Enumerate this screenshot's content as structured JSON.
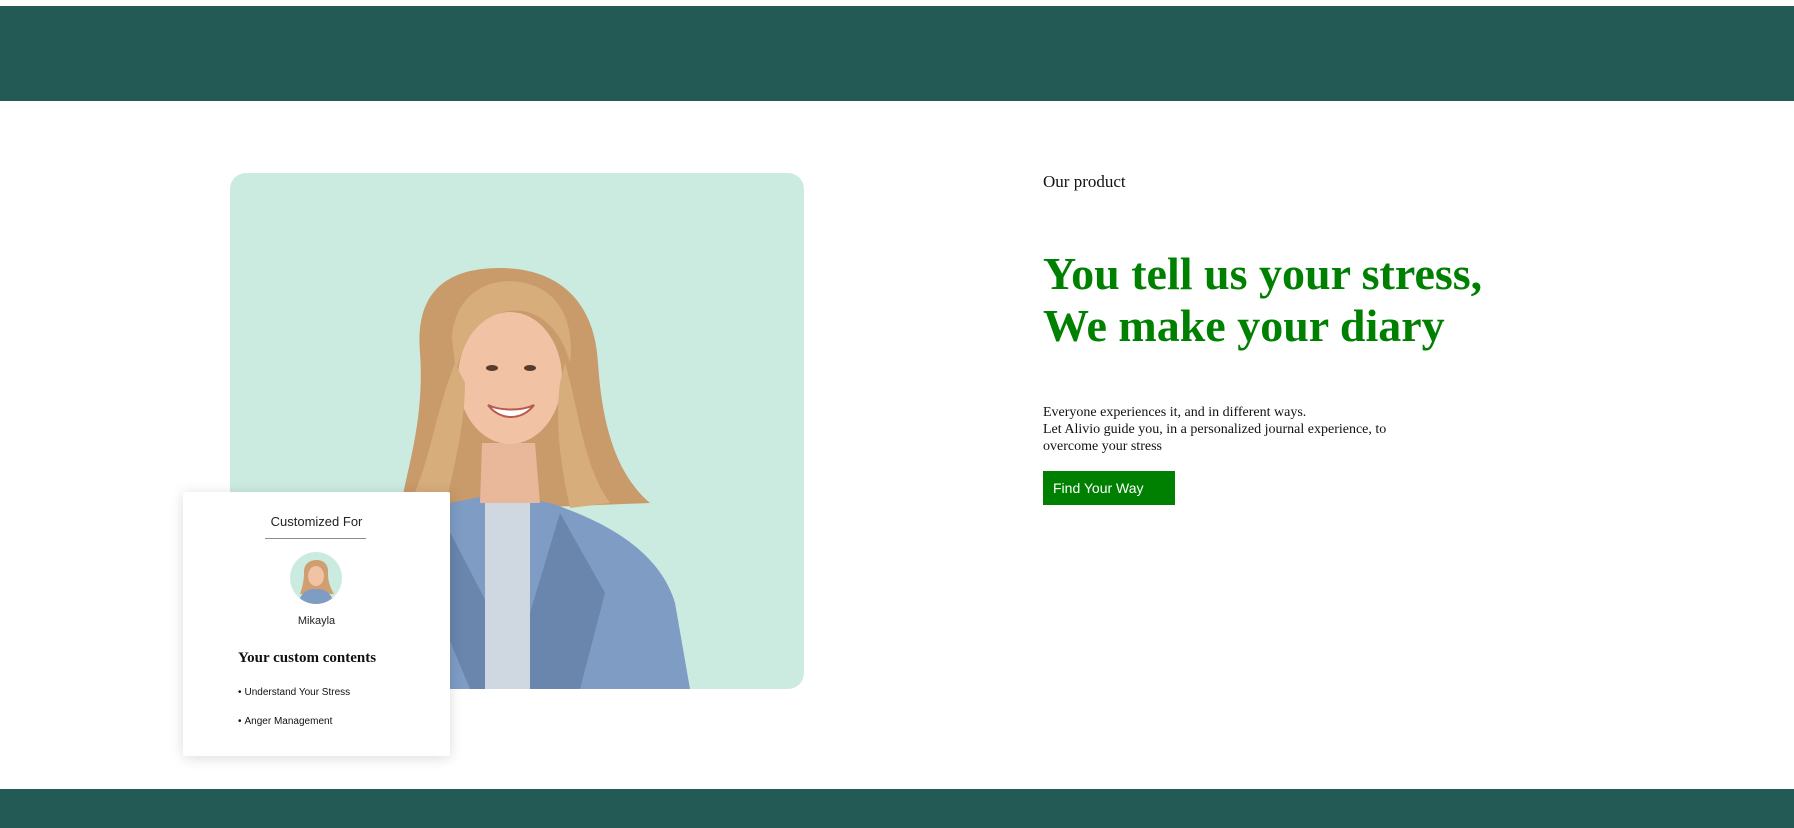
{
  "colors": {
    "band": "#235a55",
    "hero_background": "#cbebe1",
    "accent_green": "#008000",
    "text_dark": "#111111"
  },
  "hero_image": {
    "icon": "person-portrait-icon",
    "alt": "Smiling woman in denim jacket"
  },
  "card": {
    "title": "Customized For",
    "avatar_icon": "avatar-portrait-icon",
    "name": "Mikayla",
    "heading": "Your custom contents",
    "items": [
      "Understand Your Stress",
      "Anger Management"
    ]
  },
  "product": {
    "eyebrow": "Our product",
    "headline_line1": "You tell us your stress,",
    "headline_line2": "We make your diary",
    "description_line1": "Everyone experiences it, and in different ways.",
    "description_line2": "Let Alivio guide you, in a personalized journal experience, to overcome your stress",
    "cta_label": "Find Your Way"
  }
}
